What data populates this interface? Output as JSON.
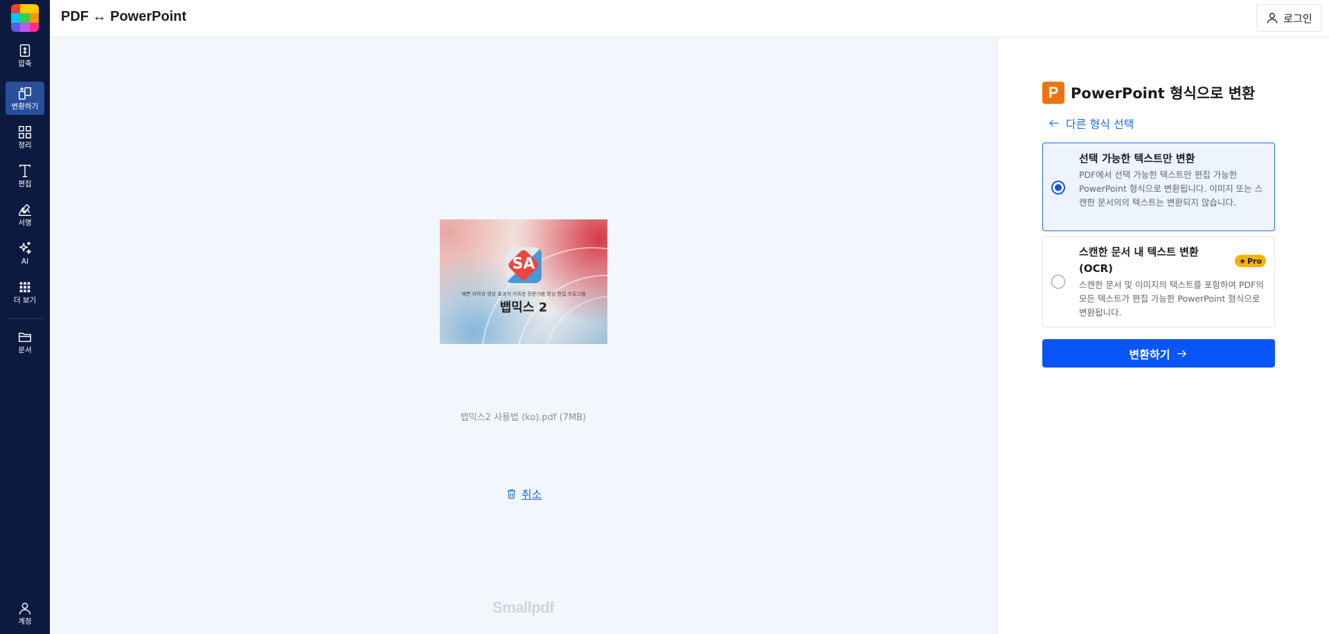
{
  "app": {
    "page_title": "PDF ↔ PowerPoint",
    "logo_colors": [
      "#ff3b30",
      "#ffcc00",
      "#ffcc00",
      "#00c8ff",
      "#31d158",
      "#ff9500",
      "#5e5ce6",
      "#bf5af2",
      "#ff2d92"
    ]
  },
  "header": {
    "login_label": "로그인",
    "login_icon": "user-icon"
  },
  "sidebar": {
    "items": [
      {
        "label": "압축",
        "icon": "compress-icon",
        "active": false
      },
      {
        "label": "변환하기",
        "icon": "convert-icon",
        "active": true
      },
      {
        "label": "정리",
        "icon": "grid-icon",
        "active": false
      },
      {
        "label": "편집",
        "icon": "text-edit-icon",
        "active": false
      },
      {
        "label": "서명",
        "icon": "signature-icon",
        "active": false
      },
      {
        "label": "AI",
        "icon": "sparkle-icon",
        "active": false
      },
      {
        "label": "더 보기",
        "icon": "apps-icon",
        "active": false
      },
      {
        "label": "문서",
        "icon": "folder-icon",
        "active": false
      }
    ],
    "account_label": "계정"
  },
  "preview": {
    "thumbnail_caption": "예쁜 자막과 영상 효과가 가득한 전문가용 영상 편집 프로그램",
    "thumbnail_title": "뱁믹스 2",
    "file_info": "뱁믹스2 사용법 (ko).pdf (7MB)",
    "cancel_label": "취소",
    "watermark": "Smallpdf"
  },
  "panel": {
    "title": "PowerPoint 형식으로 변환",
    "icon_letter": "P",
    "back_label": "다른 형식 선택",
    "options": [
      {
        "title": "선택 가능한 텍스트만 변환",
        "description": "PDF에서 선택 가능한 텍스트만 편집 가능한 PowerPoint 형식으로 변환됩니다. 이미지 또는 스캔한 문서의의 텍스트는 변환되지 않습니다.",
        "selected": true
      },
      {
        "title": "스캔한 문서 내 텍스트 변환 (OCR)",
        "description": "스캔한 문서 및 이미지의 텍스트를 포함하여 PDF의 모든 텍스트가 편집 가능한 PowerPoint 형식으로 변환됩니다.",
        "selected": false,
        "badge": "Pro"
      }
    ],
    "convert_label": "변환하기"
  },
  "colors": {
    "sidebar_bg": "#0c1a3f",
    "primary": "#0a55f5",
    "link": "#1f6bd6",
    "ppt_orange": "#f0720f",
    "pro_yellow": "#f5b400"
  }
}
